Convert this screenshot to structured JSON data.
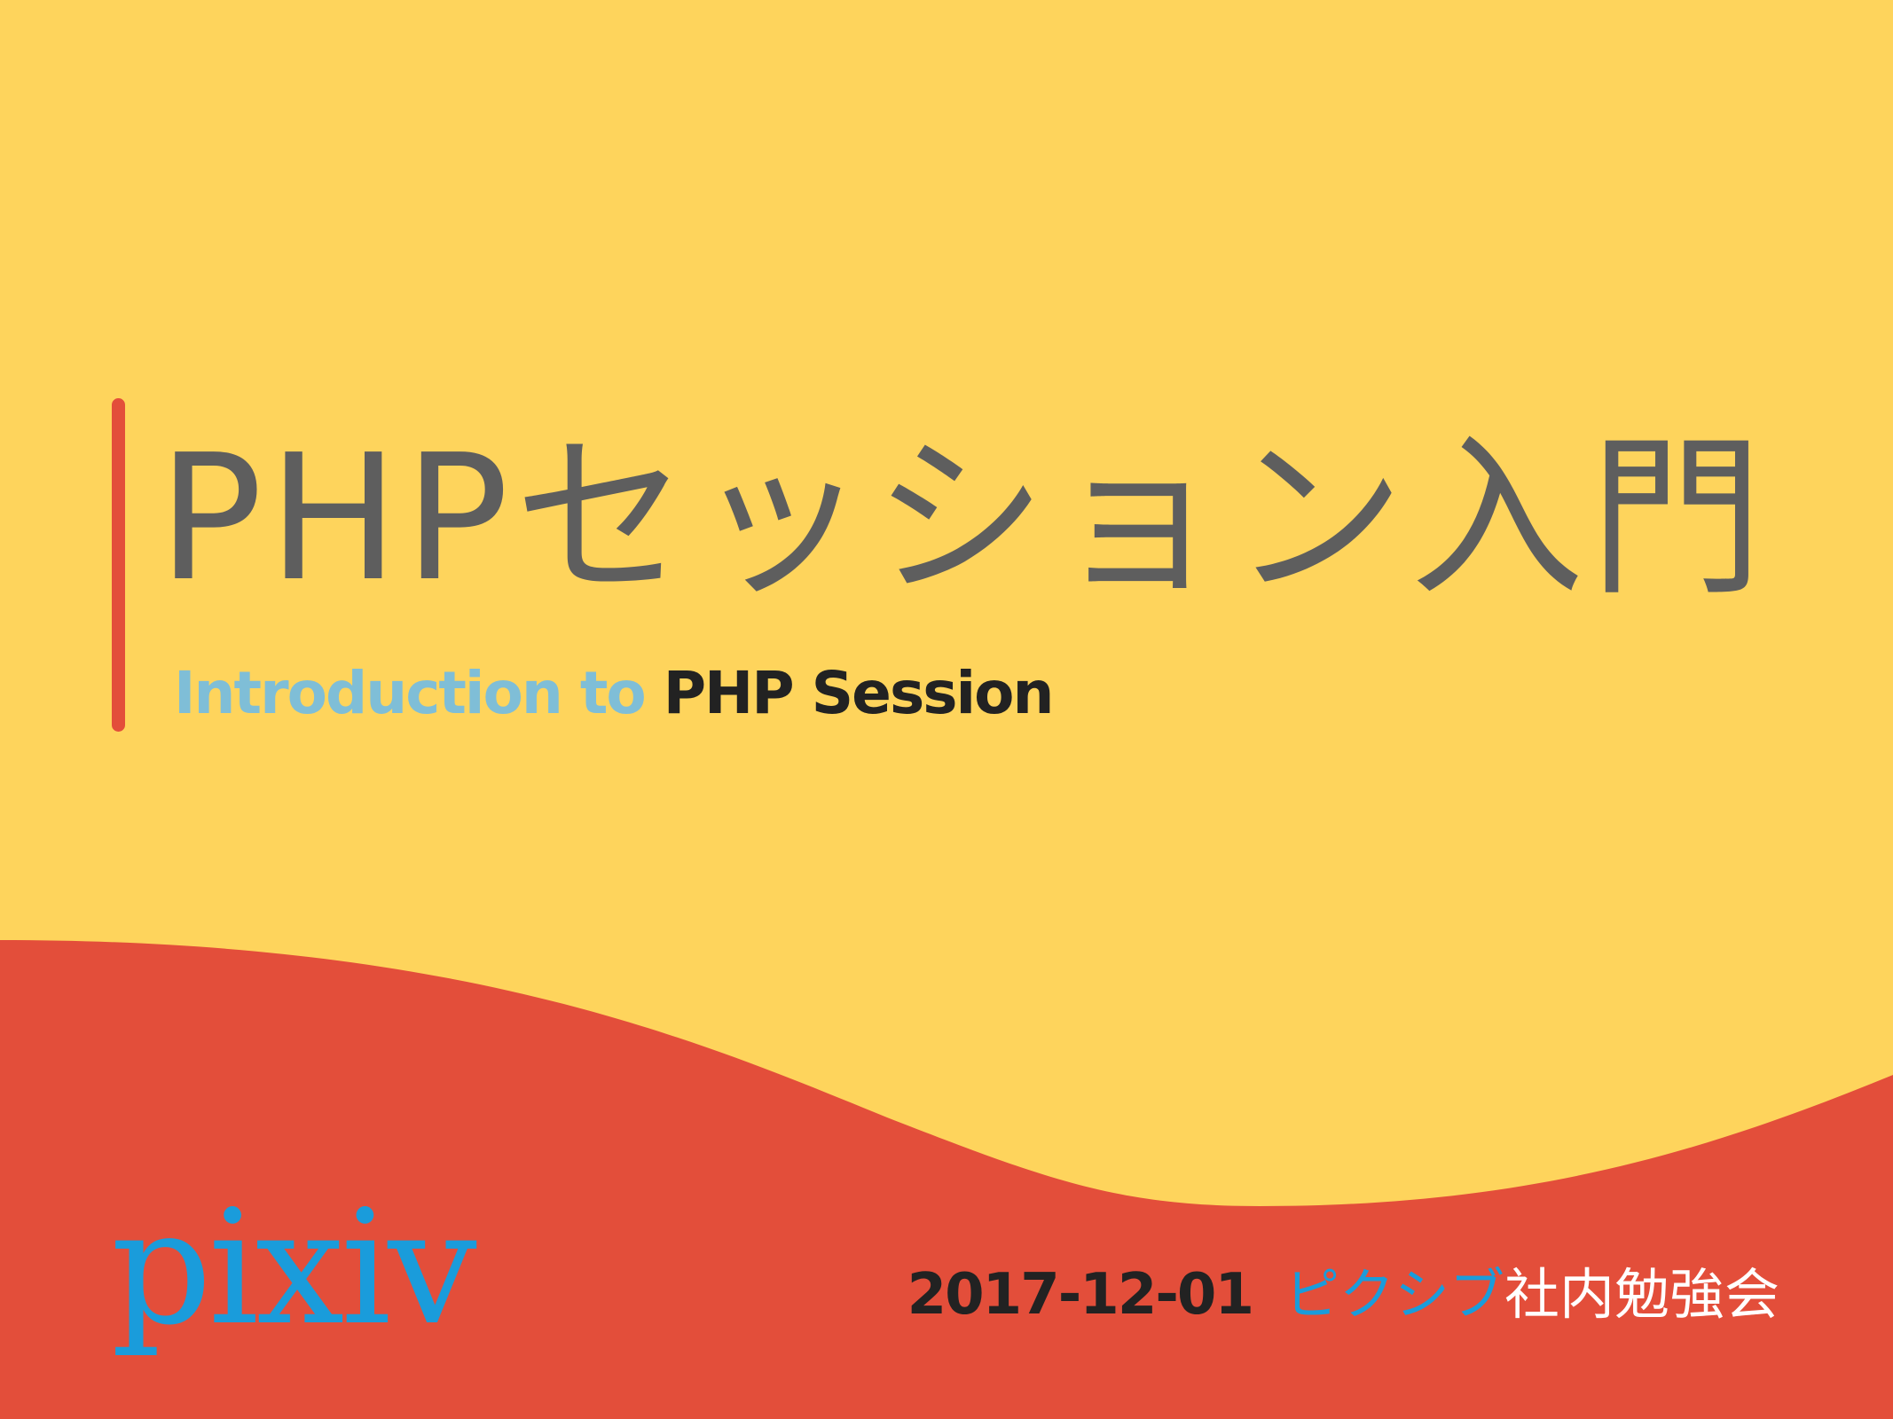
{
  "slide": {
    "title": "PHPセッション入門",
    "subtitle": {
      "part1": "Introduction to ",
      "part2": "PHP Session"
    },
    "logo": "pixiv",
    "event": {
      "date": "2017-12-01",
      "name_blue": "ピクシブ",
      "name_white": "社内勉強会"
    }
  },
  "colors": {
    "background_yellow": "#FED45C",
    "accent_red": "#E34E3A",
    "title_gray": "#5E5E5E",
    "subtitle_blue": "#7FBED7",
    "text_dark": "#222222",
    "pixiv_blue": "#1A9CDB"
  }
}
